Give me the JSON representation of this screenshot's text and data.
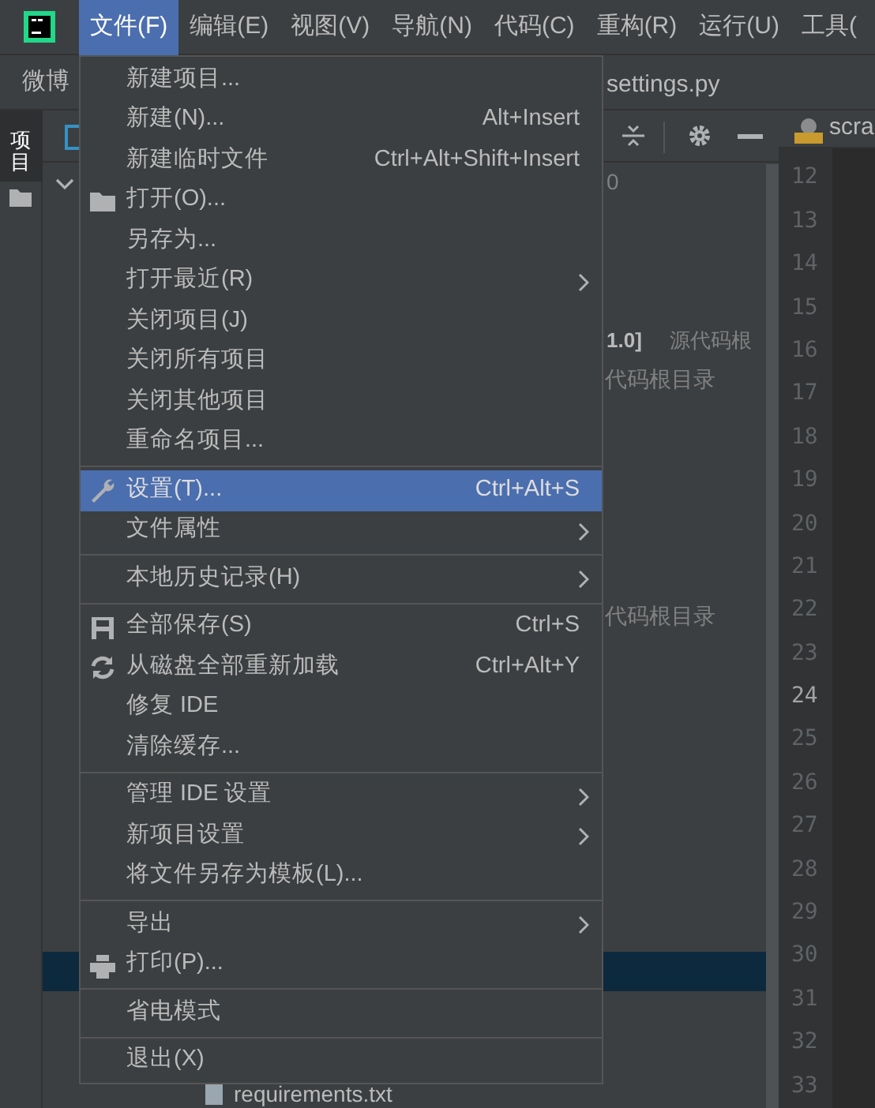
{
  "menu_bar": [
    {
      "label": "文件(F)",
      "selected": true
    },
    {
      "label": "编辑(E)",
      "selected": false
    },
    {
      "label": "视图(V)",
      "selected": false
    },
    {
      "label": "导航(N)",
      "selected": false
    },
    {
      "label": "代码(C)",
      "selected": false
    },
    {
      "label": "重构(R)",
      "selected": false
    },
    {
      "label": "运行(U)",
      "selected": false
    },
    {
      "label": "工具(",
      "selected": false
    }
  ],
  "breadcrumb": {
    "project": "微博",
    "file": "settings.py"
  },
  "side_tab": {
    "label": "项目",
    "selected": true
  },
  "editor_tab": {
    "label": "scra"
  },
  "project_tree": {
    "rows": [
      {
        "text": "0"
      },
      {
        "name": "1.0]",
        "note": "源代码根"
      },
      {
        "note": "代码根目录"
      },
      {
        "note": "代码根目录"
      },
      {
        "selected": true
      },
      {
        "text": "requirements.txt"
      }
    ]
  },
  "line_numbers": [
    {
      "text": "12",
      "current": false
    },
    {
      "text": "13",
      "current": false
    },
    {
      "text": "14",
      "current": false
    },
    {
      "text": "15",
      "current": false
    },
    {
      "text": "16",
      "current": false
    },
    {
      "text": "17",
      "current": false
    },
    {
      "text": "18",
      "current": false
    },
    {
      "text": "19",
      "current": false
    },
    {
      "text": "20",
      "current": false
    },
    {
      "text": "21",
      "current": false
    },
    {
      "text": "22",
      "current": false
    },
    {
      "text": "23",
      "current": false
    },
    {
      "text": "24",
      "current": true
    },
    {
      "text": "25",
      "current": false
    },
    {
      "text": "26",
      "current": false
    },
    {
      "text": "27",
      "current": false
    },
    {
      "text": "28",
      "current": false
    },
    {
      "text": "29",
      "current": false
    },
    {
      "text": "30",
      "current": false
    },
    {
      "text": "31",
      "current": false
    },
    {
      "text": "32",
      "current": false
    },
    {
      "text": "33",
      "current": false
    }
  ],
  "file_menu": {
    "groups": [
      {
        "items": [
          {
            "label": "新建项目...",
            "submenu": false,
            "selected": false
          },
          {
            "label": "新建(N)...",
            "shortcut": "Alt+Insert",
            "submenu": false,
            "selected": false
          },
          {
            "label": "新建临时文件",
            "shortcut": "Ctrl+Alt+Shift+Insert",
            "submenu": false,
            "selected": false
          },
          {
            "label": "打开(O)...",
            "submenu": false,
            "selected": false
          },
          {
            "label": "另存为...",
            "submenu": false,
            "selected": false
          },
          {
            "label": "打开最近(R)",
            "submenu": true,
            "selected": false
          },
          {
            "label": "关闭项目(J)",
            "submenu": false,
            "selected": false
          },
          {
            "label": "关闭所有项目",
            "submenu": false,
            "selected": false
          },
          {
            "label": "关闭其他项目",
            "submenu": false,
            "selected": false
          },
          {
            "label": "重命名项目...",
            "submenu": false,
            "selected": false
          }
        ]
      },
      {
        "items": [
          {
            "label": "设置(T)...",
            "shortcut": "Ctrl+Alt+S",
            "submenu": false,
            "selected": true
          },
          {
            "label": "文件属性",
            "submenu": true,
            "selected": false
          }
        ]
      },
      {
        "items": [
          {
            "label": "本地历史记录(H)",
            "submenu": true,
            "selected": false
          }
        ]
      },
      {
        "items": [
          {
            "label": "全部保存(S)",
            "shortcut": "Ctrl+S",
            "submenu": false,
            "selected": false
          },
          {
            "label": "从磁盘全部重新加载",
            "shortcut": "Ctrl+Alt+Y",
            "submenu": false,
            "selected": false
          },
          {
            "label": "修复 IDE",
            "submenu": false,
            "selected": false
          },
          {
            "label": "清除缓存...",
            "submenu": false,
            "selected": false
          }
        ]
      },
      {
        "items": [
          {
            "label": "管理 IDE 设置",
            "submenu": true,
            "selected": false
          },
          {
            "label": "新项目设置",
            "submenu": true,
            "selected": false
          },
          {
            "label": "将文件另存为模板(L)...",
            "submenu": false,
            "selected": false
          }
        ]
      },
      {
        "items": [
          {
            "label": "导出",
            "submenu": true,
            "selected": false
          },
          {
            "label": "打印(P)...",
            "submenu": false,
            "selected": false
          }
        ]
      },
      {
        "items": [
          {
            "label": "省电模式",
            "submenu": false,
            "selected": false
          }
        ]
      },
      {
        "items": [
          {
            "label": "退出(X)",
            "submenu": false,
            "selected": false
          }
        ]
      }
    ]
  }
}
